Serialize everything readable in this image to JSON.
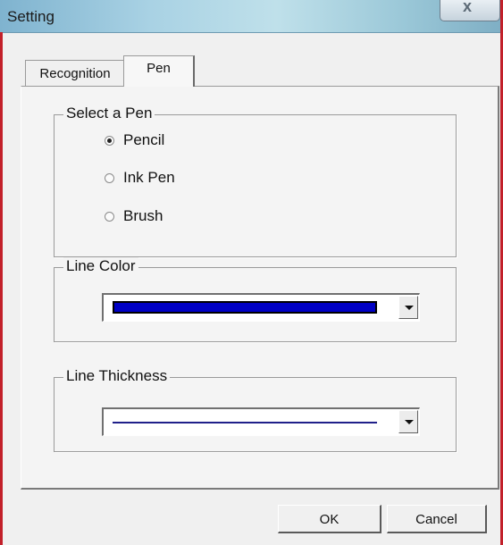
{
  "window": {
    "title": "Setting",
    "close_icon": "close-icon"
  },
  "tabs": [
    {
      "label": "Recognition",
      "selected": false
    },
    {
      "label": "Pen",
      "selected": true
    }
  ],
  "pen_group": {
    "legend": "Select a Pen",
    "options": [
      {
        "label": "Pencil",
        "checked": true
      },
      {
        "label": "Ink Pen",
        "checked": false
      },
      {
        "label": "Brush",
        "checked": false
      }
    ]
  },
  "color_group": {
    "legend": "Line Color",
    "selected_color": "#0000c4"
  },
  "thickness_group": {
    "legend": "Line Thickness",
    "line_color": "#20208a"
  },
  "buttons": {
    "ok": "OK",
    "cancel": "Cancel"
  }
}
